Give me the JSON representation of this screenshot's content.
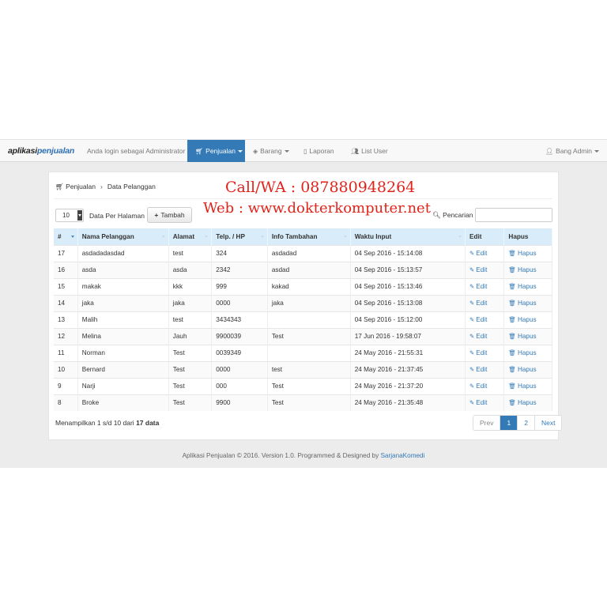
{
  "navbar": {
    "brand_a": "aplikasi",
    "brand_b": "penjualan",
    "login_text": "Anda login sebagai Administrator",
    "menu": [
      {
        "label": "Penjualan",
        "icon": "cart-icon",
        "active": true
      },
      {
        "label": "Barang",
        "icon": "box-icon"
      },
      {
        "label": "Laporan",
        "icon": "document-icon"
      },
      {
        "label": "List User",
        "icon": "users-icon"
      }
    ],
    "user": "Bang Admin"
  },
  "breadcrumb": [
    "Penjualan",
    "Data Pelanggan"
  ],
  "watermark": {
    "line1": "Call/WA : 087880948264",
    "line2": "Web : www.dokterkomputer.net"
  },
  "controls": {
    "page_size_value": "10",
    "page_size_label": "Data Per Halaman",
    "add_label": "Tambah",
    "search_label": "Pencarian :"
  },
  "table": {
    "columns": [
      "#",
      "Nama Pelanggan",
      "Alamat",
      "Telp. / HP",
      "Info Tambahan",
      "Waktu Input",
      "Edit",
      "Hapus"
    ],
    "edit_label": "Edit",
    "delete_label": "Hapus",
    "rows": [
      {
        "no": "17",
        "nama": "asdadadasdad",
        "alamat": "test",
        "telp": "324",
        "info": "asdadad",
        "waktu": "04 Sep 2016 - 15:14:08"
      },
      {
        "no": "16",
        "nama": "asda",
        "alamat": "asda",
        "telp": "2342",
        "info": "asdad",
        "waktu": "04 Sep 2016 - 15:13:57"
      },
      {
        "no": "15",
        "nama": "makak",
        "alamat": "kkk",
        "telp": "999",
        "info": "kakad",
        "waktu": "04 Sep 2016 - 15:13:46"
      },
      {
        "no": "14",
        "nama": "jaka",
        "alamat": "jaka",
        "telp": "0000",
        "info": "jaka",
        "waktu": "04 Sep 2016 - 15:13:08"
      },
      {
        "no": "13",
        "nama": "Malih",
        "alamat": "test",
        "telp": "3434343",
        "info": "",
        "waktu": "04 Sep 2016 - 15:12:00"
      },
      {
        "no": "12",
        "nama": "Melina",
        "alamat": "Jauh",
        "telp": "9900039",
        "info": "Test",
        "waktu": "17 Jun 2016 - 19:58:07"
      },
      {
        "no": "11",
        "nama": "Norman",
        "alamat": "Test",
        "telp": "0039349",
        "info": "",
        "waktu": "24 May 2016 - 21:55:31"
      },
      {
        "no": "10",
        "nama": "Bernard",
        "alamat": "Test",
        "telp": "0000",
        "info": "test",
        "waktu": "24 May 2016 - 21:37:45"
      },
      {
        "no": "9",
        "nama": "Narji",
        "alamat": "Test",
        "telp": "000",
        "info": "Test",
        "waktu": "24 May 2016 - 21:37:20"
      },
      {
        "no": "8",
        "nama": "Broke",
        "alamat": "Test",
        "telp": "9900",
        "info": "Test",
        "waktu": "24 May 2016 - 21:35:48"
      }
    ]
  },
  "summary": {
    "text": "Menampilkan 1 s/d 10 dari ",
    "bold": "17 data"
  },
  "pagination": {
    "prev": "Prev",
    "pages": [
      "1",
      "2"
    ],
    "current": "1",
    "next": "Next"
  },
  "footer": {
    "text": "Aplikasi Penjualan © 2016. Version 1.0. Programmed & Designed by ",
    "link": "SarjanaKomedi"
  },
  "colors": {
    "accent": "#337ab7",
    "header_bg": "#d9ecf9",
    "watermark": "#e2231a"
  }
}
